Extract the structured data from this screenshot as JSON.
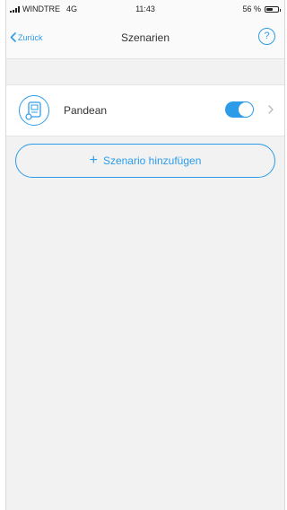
{
  "status_bar": {
    "carrier": "WINDTRE",
    "network": "4G",
    "time": "11:43",
    "battery": "56 %",
    "battery_level": 0.56
  },
  "nav": {
    "back_label": "Zurück",
    "title": "Szenarien",
    "help_label": "?"
  },
  "scenarios": [
    {
      "name": "Pandean",
      "enabled": true,
      "icon": "scenario-device-icon"
    }
  ],
  "add_button": {
    "label": "Szenario hinzufügen",
    "icon": "plus-icon"
  },
  "colors": {
    "accent": "#2d9ce8",
    "background": "#f2f2f2",
    "row_background": "#ffffff"
  }
}
